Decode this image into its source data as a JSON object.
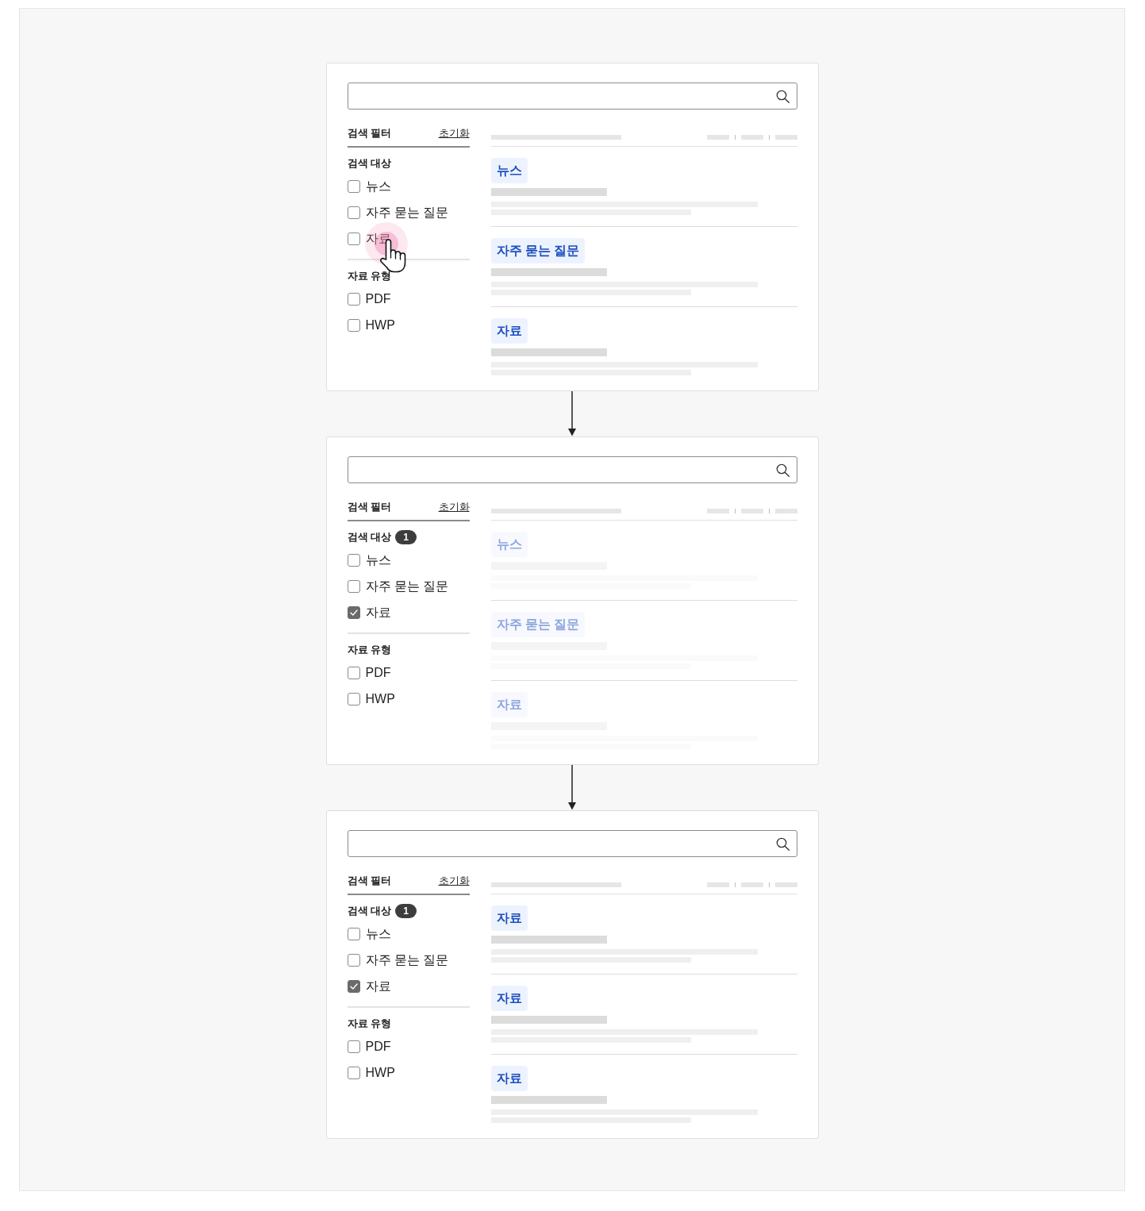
{
  "steps": [
    {
      "filter": {
        "title": "검색 필터",
        "reset": "초기화",
        "groups": [
          {
            "title": "검색 대상",
            "options": [
              {
                "label": "뉴스",
                "checked": false,
                "clicked": false
              },
              {
                "label": "자주 묻는 질문",
                "checked": false,
                "clicked": false
              },
              {
                "label": "자료",
                "checked": false,
                "clicked": true
              }
            ]
          },
          {
            "title": "자료 유형",
            "options": [
              {
                "label": "PDF",
                "checked": false,
                "clicked": false
              },
              {
                "label": "HWP",
                "checked": false,
                "clicked": false
              }
            ]
          }
        ]
      },
      "results": {
        "dimmed": false,
        "items": [
          {
            "tag": "뉴스"
          },
          {
            "tag": "자주 묻는 질문"
          },
          {
            "tag": "자료"
          }
        ]
      }
    },
    {
      "filter": {
        "title": "검색 필터",
        "reset": "초기화",
        "groups": [
          {
            "title": "검색 대상",
            "count": "1",
            "options": [
              {
                "label": "뉴스",
                "checked": false,
                "clicked": false
              },
              {
                "label": "자주 묻는 질문",
                "checked": false,
                "clicked": false
              },
              {
                "label": "자료",
                "checked": true,
                "clicked": false
              }
            ]
          },
          {
            "title": "자료 유형",
            "options": [
              {
                "label": "PDF",
                "checked": false,
                "clicked": false
              },
              {
                "label": "HWP",
                "checked": false,
                "clicked": false
              }
            ]
          }
        ]
      },
      "results": {
        "dimmed": true,
        "items": [
          {
            "tag": "뉴스"
          },
          {
            "tag": "자주 묻는 질문"
          },
          {
            "tag": "자료"
          }
        ]
      }
    },
    {
      "filter": {
        "title": "검색 필터",
        "reset": "초기화",
        "groups": [
          {
            "title": "검색 대상",
            "count": "1",
            "options": [
              {
                "label": "뉴스",
                "checked": false,
                "clicked": false
              },
              {
                "label": "자주 묻는 질문",
                "checked": false,
                "clicked": false
              },
              {
                "label": "자료",
                "checked": true,
                "clicked": false
              }
            ]
          },
          {
            "title": "자료 유형",
            "options": [
              {
                "label": "PDF",
                "checked": false,
                "clicked": false
              },
              {
                "label": "HWP",
                "checked": false,
                "clicked": false
              }
            ]
          }
        ]
      },
      "results": {
        "dimmed": false,
        "items": [
          {
            "tag": "자료"
          },
          {
            "tag": "자료"
          },
          {
            "tag": "자료"
          }
        ]
      }
    }
  ]
}
